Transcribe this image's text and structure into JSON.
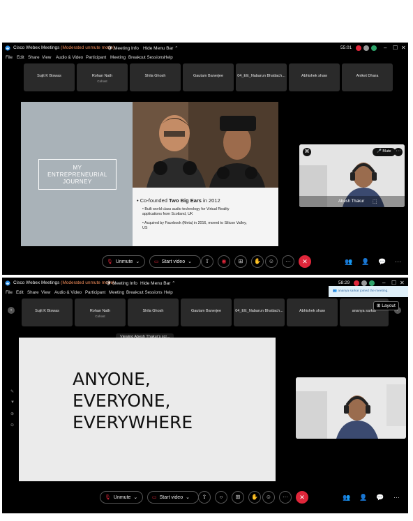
{
  "screenshot1": {
    "title": "Cisco Webex Meetings",
    "mode": "(Moderated unmute mode)",
    "meeting_info": "Meeting Info",
    "hide_menu_bar": "Hide Menu Bar",
    "timer": "55:01",
    "menu": [
      "File",
      "Edit",
      "Share",
      "View",
      "Audio & Video",
      "Participant",
      "Meeting",
      "Breakout Sessions",
      "Help"
    ],
    "participants": [
      {
        "name": "Sujit K Biswas",
        "sub": ""
      },
      {
        "name": "Rohan Nath",
        "sub": "Cohost"
      },
      {
        "name": "Shila Ghosh",
        "sub": ""
      },
      {
        "name": "Gautam Banerjee",
        "sub": ""
      },
      {
        "name": "04_EE_Nabarun Bhattach...",
        "sub": ""
      },
      {
        "name": "Abhishek shaw",
        "sub": ""
      },
      {
        "name": "Aniket Dhara",
        "sub": ""
      }
    ],
    "slide": {
      "box_line1": "MY",
      "box_line2": "ENTREPRENEURIAL",
      "box_line3": "JOURNEY",
      "heading_pre": "Co-founded ",
      "heading_bold": "Two Big Ears",
      "heading_post": " in 2012",
      "bullet1": "Built world class audio technology for Virtual Reality applications from Scotland, UK",
      "bullet2": "Acquired by Facebook (Meta) in 2016, moved to Silicon Valley, US"
    },
    "video": {
      "name": "Abesh Thakur",
      "mute_label": "Mute"
    },
    "controls": {
      "unmute": "Unmute",
      "start_video": "Start video"
    }
  },
  "screenshot2": {
    "title": "Cisco Webex Meetings",
    "mode": "(Moderated unmute mode)",
    "meeting_info": "Meeting Info",
    "hide_menu_bar": "Hide Menu Bar",
    "timer": "58:29",
    "notification": "ananya sarkar joined the meeting.",
    "layout": "Layout",
    "menu": [
      "File",
      "Edit",
      "Share",
      "View",
      "Audio & Video",
      "Participant",
      "Meeting",
      "Breakout Sessions",
      "Help"
    ],
    "participants": [
      {
        "name": "Sujit K Biswas",
        "sub": ""
      },
      {
        "name": "Rohan Nath",
        "sub": "Cohost"
      },
      {
        "name": "Shila Ghosh",
        "sub": ""
      },
      {
        "name": "Gautam Banerjee",
        "sub": ""
      },
      {
        "name": "04_EE_Nabarun Bhattach...",
        "sub": ""
      },
      {
        "name": "Abhishek shaw",
        "sub": ""
      },
      {
        "name": "ananya sarkar",
        "sub": ""
      }
    ],
    "viewing": "Viewing Abesh Thakur's scr...",
    "slide": {
      "line1": "ANYONE,",
      "line2": "EVERYONE,",
      "line3": "EVERYWHERE"
    },
    "controls": {
      "unmute": "Unmute",
      "start_video": "Start video"
    }
  },
  "colors": {
    "end_call": "#e0263a",
    "mode_text": "#f08c5a",
    "notification_bg": "#dfeff8"
  }
}
